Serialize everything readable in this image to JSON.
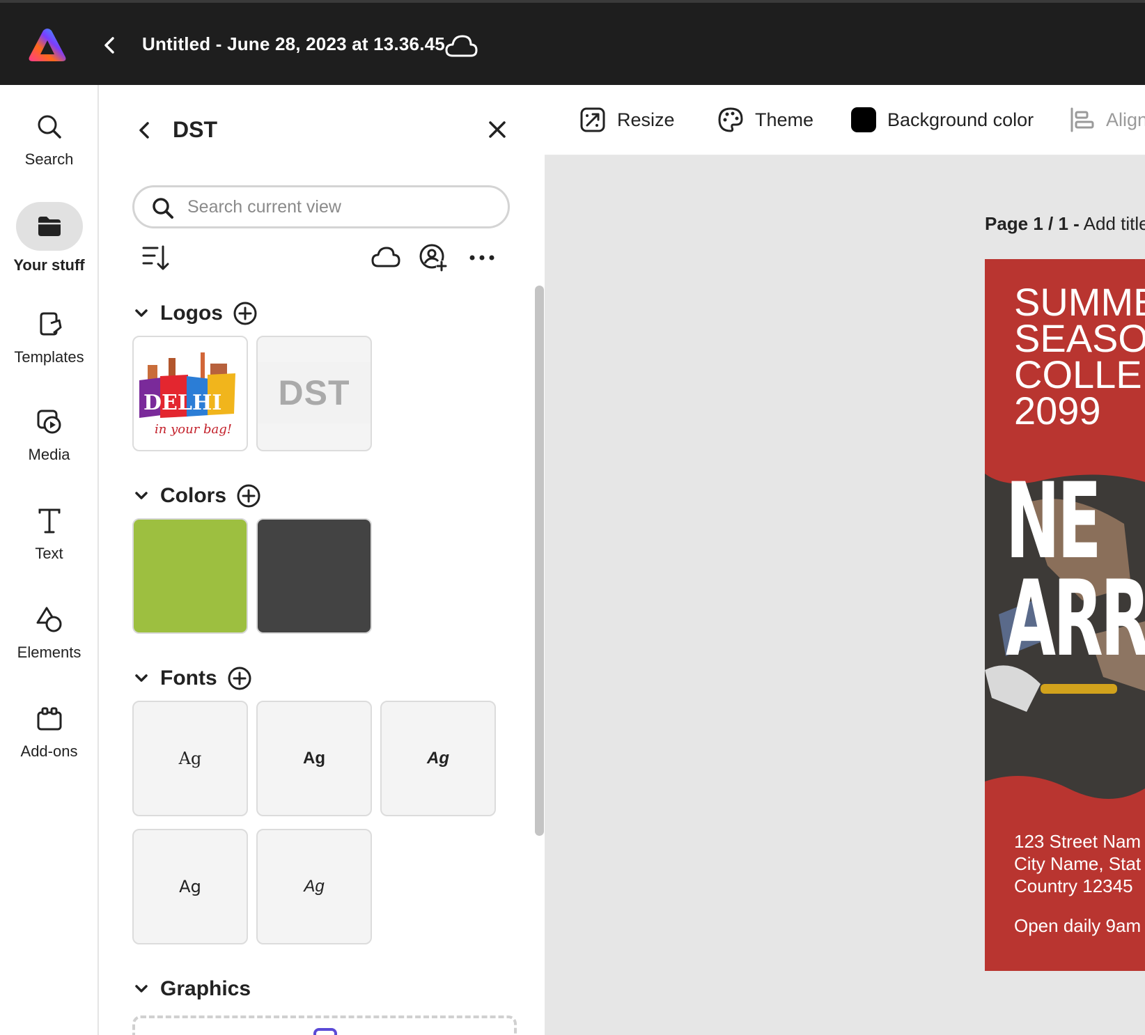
{
  "app": {
    "document_title": "Untitled - June 28, 2023 at 13.36.45"
  },
  "rail": {
    "items": [
      {
        "label": "Search",
        "icon": "search-icon"
      },
      {
        "label": "Your stuff",
        "icon": "folder-icon",
        "active": true
      },
      {
        "label": "Templates",
        "icon": "templates-icon"
      },
      {
        "label": "Media",
        "icon": "media-icon"
      },
      {
        "label": "Text",
        "icon": "text-icon"
      },
      {
        "label": "Elements",
        "icon": "elements-icon"
      },
      {
        "label": "Add-ons",
        "icon": "add-ons-icon"
      }
    ]
  },
  "panel": {
    "title": "DST",
    "search_placeholder": "Search current view",
    "sections": {
      "logos": {
        "label": "Logos",
        "items": [
          "Delhi in your bag logo",
          "DST"
        ],
        "dst_text": "DST"
      },
      "colors": {
        "label": "Colors",
        "swatches": [
          "#9dbf40",
          "#434343"
        ]
      },
      "fonts": {
        "label": "Fonts",
        "samples": [
          "Ag",
          "Ag",
          "Ag",
          "Ag",
          "Ag"
        ]
      },
      "graphics": {
        "label": "Graphics"
      }
    }
  },
  "toolbar": {
    "resize": "Resize",
    "theme": "Theme",
    "background_color": "Background color",
    "background_swatch": "#000000",
    "align": "Align"
  },
  "canvas": {
    "page_number": "Page 1 / 1 -",
    "page_title_placeholder": "Add title",
    "poster": {
      "headline": "SUMME\nSEASO\nCOLLE\n2099",
      "big_line_1": "NE",
      "big_line_2": "ARRI",
      "address": "123 Street Nam\nCity Name, Stat\nCountry 12345",
      "hours": "Open daily 9am",
      "background_color": "#b93530"
    }
  }
}
